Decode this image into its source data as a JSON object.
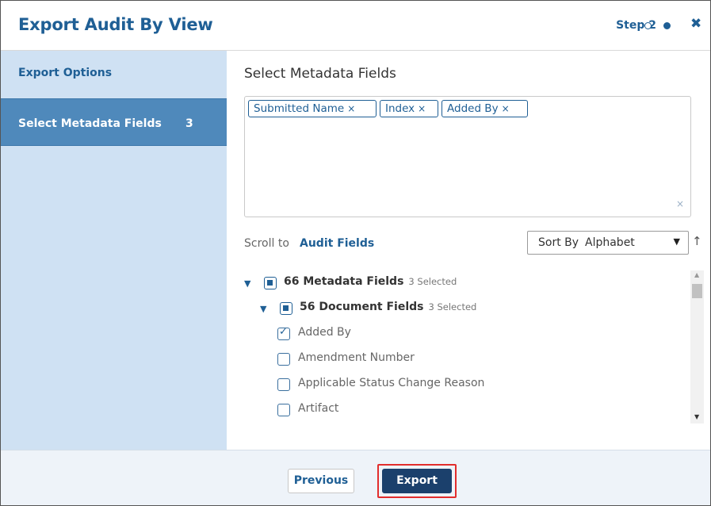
{
  "dialog": {
    "title": "Export Audit By View",
    "step_label": "Step 2",
    "close_glyph": "✖"
  },
  "sidebar": {
    "items": [
      {
        "label": "Export Options",
        "count": "",
        "active": false
      },
      {
        "label": "Select Metadata Fields",
        "count": "3",
        "active": true
      }
    ]
  },
  "main": {
    "title": "Select Metadata Fields",
    "tags": [
      {
        "label": "Submitted Name",
        "remove": "×"
      },
      {
        "label": "Index",
        "remove": "×"
      },
      {
        "label": "Added By",
        "remove": "×"
      }
    ],
    "clear_glyph": "×",
    "scroll_to_label": "Scroll to",
    "scroll_to_link": "Audit Fields",
    "sort": {
      "label": "Sort By",
      "value": "Alphabet",
      "caret": "▼",
      "direction_glyph": "↑"
    },
    "tree": [
      {
        "label": "66 Metadata Fields",
        "selected": "3 Selected",
        "expanded": true,
        "level": 0
      },
      {
        "label": "56 Document Fields",
        "selected": "3 Selected",
        "expanded": true,
        "level": 1
      },
      {
        "label": "Added By",
        "checked": true,
        "level": 2
      },
      {
        "label": "Amendment Number",
        "checked": false,
        "level": 2
      },
      {
        "label": "Applicable Status Change Reason",
        "checked": false,
        "level": 2
      },
      {
        "label": "Artifact",
        "checked": false,
        "level": 2
      }
    ]
  },
  "footer": {
    "previous_label": "Previous",
    "export_label": "Export"
  },
  "colors": {
    "accent": "#1f5f95",
    "sidebar_bg": "#cfe1f3",
    "sidebar_active": "#4f89bb",
    "primary_button": "#1b406c",
    "highlight": "#e22d2d"
  }
}
